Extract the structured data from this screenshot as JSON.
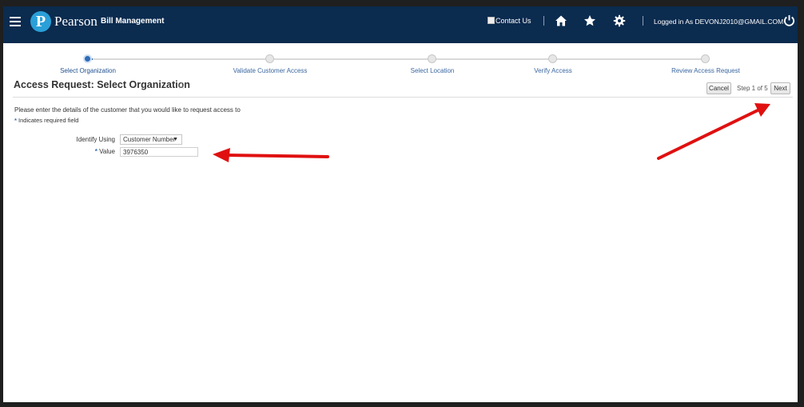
{
  "header": {
    "brand": "Pearson",
    "product": "Bill Management",
    "contact_label": "Contact Us",
    "user_label": "Logged in As DEVONJ2010@GMAIL.COM",
    "icons": [
      "menu-icon",
      "home-icon",
      "favorites-star-icon",
      "settings-gear-icon",
      "power-icon"
    ]
  },
  "train": {
    "steps": [
      {
        "label": "Select Organization",
        "active": true
      },
      {
        "label": "Validate Customer Access",
        "active": false
      },
      {
        "label": "Select Location",
        "active": false
      },
      {
        "label": "Verify Access",
        "active": false
      },
      {
        "label": "Review Access Request",
        "active": false
      }
    ]
  },
  "page": {
    "title": "Access Request: Select Organization",
    "cancel_label": "Cancel",
    "step_text": "Step 1 of 5",
    "next_label": "Next",
    "instructions": "Please enter the details of the customer that you would like to request access to",
    "required_note": "Indicates required field",
    "required_marker": "*"
  },
  "form": {
    "identify_label": "Identify Using",
    "identify_value": "Customer Number",
    "value_label": "Value",
    "value_input": "3976350"
  },
  "colors": {
    "header_bg": "#0b2b4f",
    "accent": "#2e6cb7",
    "annotation_arrow": "#e01010"
  }
}
